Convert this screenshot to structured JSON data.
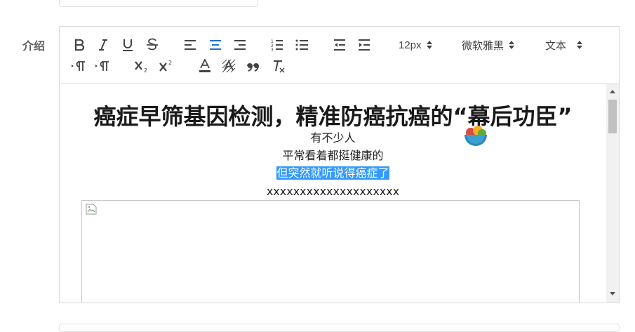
{
  "form": {
    "intro_label": "介绍"
  },
  "toolbar": {
    "font_size": "12px",
    "font_family": "微软雅黑",
    "text_style": "文本",
    "icons": [
      "bold-icon",
      "italic-icon",
      "underline-icon",
      "strikethrough-icon",
      "align-left-icon",
      "align-center-icon",
      "align-right-icon",
      "ordered-list-icon",
      "bullet-list-icon",
      "outdent-icon",
      "indent-icon",
      "ltr-icon",
      "rtl-icon",
      "subscript-icon",
      "superscript-icon",
      "font-color-icon",
      "background-color-icon",
      "blockquote-icon",
      "clear-format-icon"
    ],
    "active_icon": "align-center-icon",
    "accent_color": "#1e6fd9"
  },
  "content": {
    "headline": "癌症早筛基因检测，精准防癌抗癌的“幕后功臣”",
    "line1": "有不少人",
    "line2": "平常看着都挺健康的",
    "line3": "但突然就听说得癌症了",
    "line4": "xxxxxxxxxxxxxxxxxxxx",
    "selection_color": "#3399ff"
  }
}
